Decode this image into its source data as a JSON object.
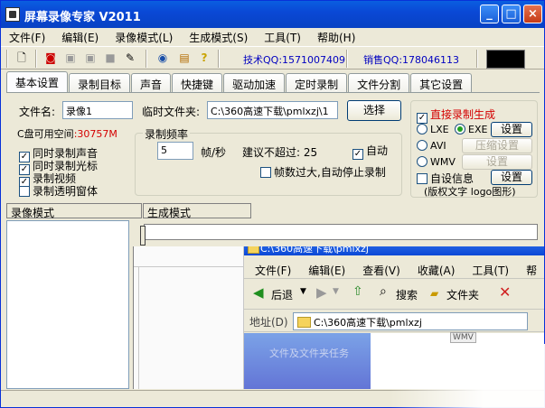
{
  "window": {
    "title": "屏幕录像专家 V2011"
  },
  "menubar": [
    "文件(F)",
    "编辑(E)",
    "录像模式(L)",
    "生成模式(S)",
    "工具(T)",
    "帮助(H)"
  ],
  "toolbar": {
    "tech_qq": "技术QQ:1571007409",
    "sales_qq": "销售QQ:178046113"
  },
  "tabs": [
    "基本设置",
    "录制目标",
    "声音",
    "快捷键",
    "驱动加速",
    "定时录制",
    "文件分割",
    "其它设置"
  ],
  "basic": {
    "filename_label": "文件名:",
    "filename_value": "录像1",
    "tempdir_label": "临时文件夹:",
    "tempdir_value": "C:\\360高速下载\\pmlxzj\\1",
    "browse_label": "选择",
    "disk_label": "C盘可用空间",
    "disk_value": ":30757M",
    "options": [
      {
        "label": "同时录制声音",
        "checked": true
      },
      {
        "label": "同时录制光标",
        "checked": true
      },
      {
        "label": "录制视频",
        "checked": true
      },
      {
        "label": "录制透明窗体",
        "checked": false
      }
    ]
  },
  "freq": {
    "title": "录制频率",
    "value": "5",
    "unit": "帧/秒",
    "suggest": "建议不超过: 25",
    "auto_label": "自动",
    "auto_checked": true,
    "stop_label": "帧数过大,自动停止录制",
    "stop_checked": false
  },
  "gen": {
    "direct_label": "直接录制生成",
    "direct_checked": true,
    "lxe": "LXE",
    "exe": "EXE",
    "avi": "AVI",
    "wmv": "WMV",
    "settings_label": "设置",
    "compress_label": "压缩设置",
    "settings2_label": "设置",
    "selfinfo_label": "自设信息",
    "settings3_label": "设置",
    "copyright_label": "(版权文字 logo图形)"
  },
  "lower": {
    "record_mode": "录像模式",
    "gen_mode": "生成模式"
  },
  "explorer": {
    "title": "C:\\360高速下载\\pmlxzj",
    "menu": [
      "文件(F)",
      "编辑(E)",
      "查看(V)",
      "收藏(A)",
      "工具(T)",
      "帮"
    ],
    "back": "后退",
    "search": "搜索",
    "folders": "文件夹",
    "address_label": "地址(D)",
    "address_value": "C:\\360高速下载\\pmlxzj",
    "ghost": "文件及文件夹任务",
    "wmv_tag": "WMV"
  }
}
